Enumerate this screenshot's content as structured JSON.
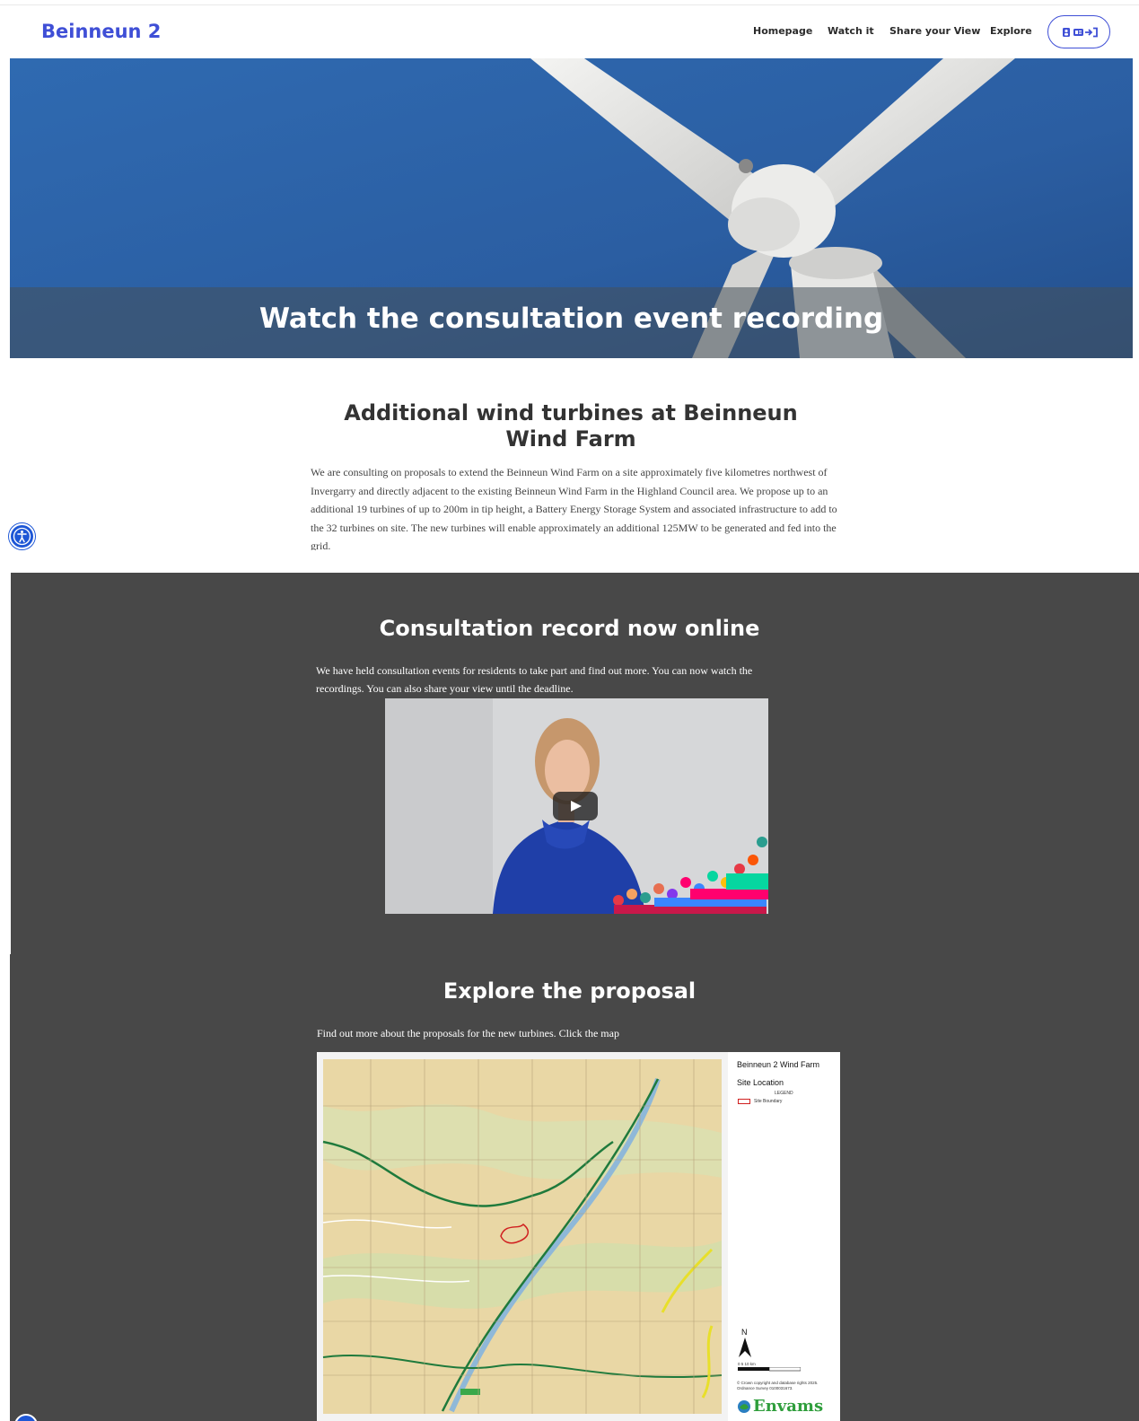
{
  "header": {
    "brand": "Beinneun 2",
    "nav": [
      "Homepage",
      "Watch it",
      "Share your View",
      "Explore"
    ],
    "login_icon": "person-card-login-icon"
  },
  "hero": {
    "title": "Watch the consultation event recording",
    "image": "wind-turbine-against-blue-sky"
  },
  "intro": {
    "title": "Additional wind turbines at Beinneun Wind Farm",
    "text": "We are consulting on proposals to extend the Beinneun Wind Farm on a site approximately five kilometres northwest of Invergarry and directly adjacent to the existing Beinneun Wind Farm in the Highland Council area. We propose up to an additional 19 turbines of up to 200m in tip height, a Battery Energy Storage System and associated infrastructure to add to the 32 turbines on site. The new turbines will enable approximately an additional 125MW to be generated and fed into the grid."
  },
  "consultation": {
    "title": "Consultation record now online",
    "text": "We have held consultation events for residents to take part and find out more. You can now watch the recordings. You can also share your view until the deadline.",
    "video_icon": "play-icon"
  },
  "explore": {
    "title": "Explore the proposal",
    "text": "Find out more about the proposals for the new turbines. Click the map",
    "map": {
      "title": "Beinneun 2 Wind Farm",
      "subtitle": "Site Location",
      "legend_heading": "LEGEND",
      "legend_item": "Site Boundary",
      "north": "N",
      "scale": "0        5        10 km",
      "copyright": "© Crown copyright and database rights 2025. Ordnance Survey 0100031673.",
      "brand": "Envams"
    }
  },
  "accessibility_icon": "accessibility-icon",
  "colors": {
    "brand": "#3f4fd6",
    "dark_section": "#484848",
    "accessibility": "#1e57d6"
  }
}
